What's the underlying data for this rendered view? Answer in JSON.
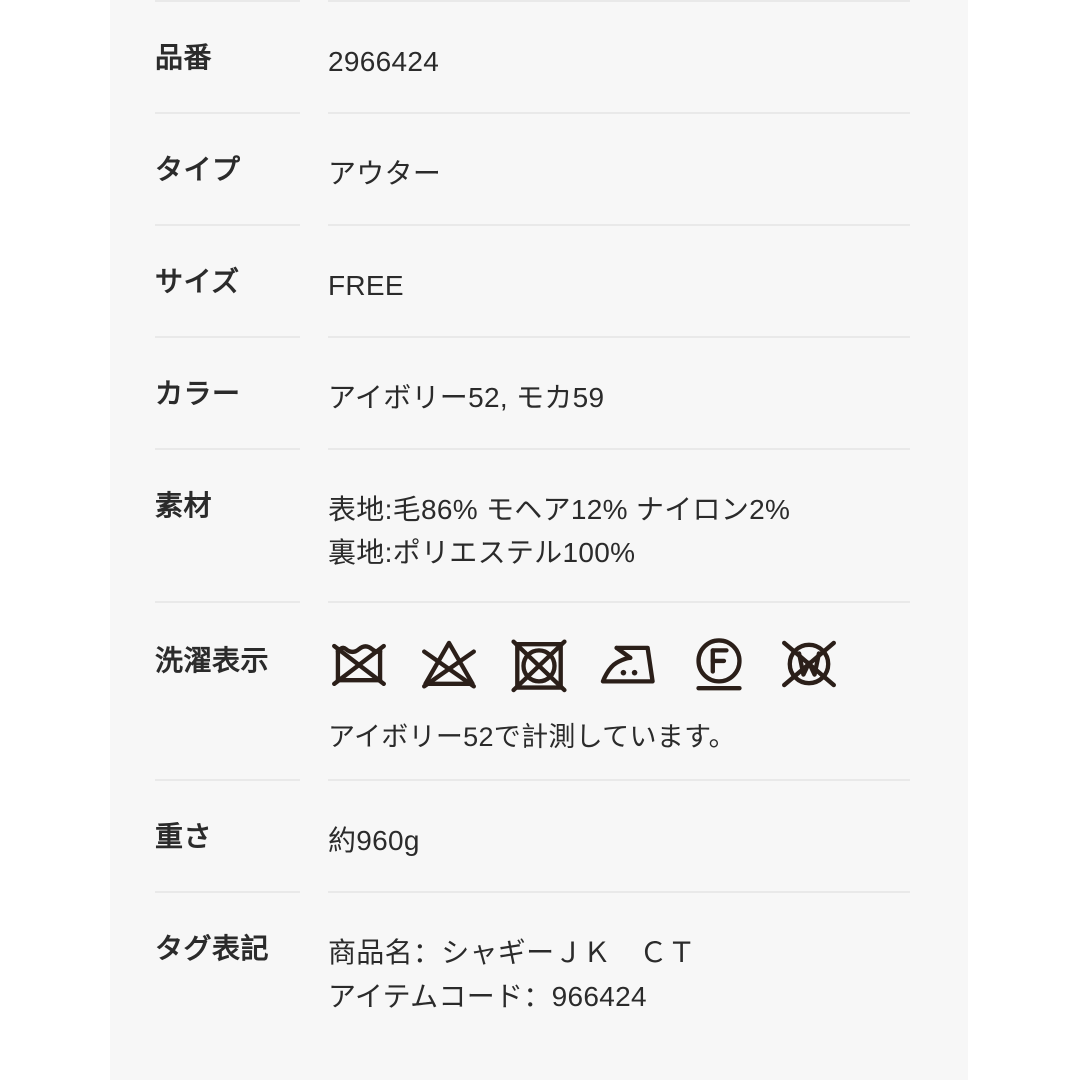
{
  "panel": {
    "background_color": "#f7f7f7",
    "page_background_color": "#ffffff",
    "divider_color": "#e9e9e9",
    "text_color": "#2b2b2b"
  },
  "spec_rows": [
    {
      "label": "品番",
      "value_lines": [
        "2966424"
      ]
    },
    {
      "label": "タイプ",
      "value_lines": [
        "アウター"
      ]
    },
    {
      "label": "サイズ",
      "value_lines": [
        "FREE"
      ]
    },
    {
      "label": "カラー",
      "value_lines": [
        "アイボリー52, モカ59"
      ]
    },
    {
      "label": "素材",
      "value_lines": [
        "表地:毛86% モヘア12% ナイロン2%",
        "裏地:ポリエステル100%"
      ]
    }
  ],
  "care": {
    "label": "洗濯表示",
    "note": "アイボリー52で計測しています。",
    "symbols": [
      {
        "name": "do-not-wash-icon",
        "title": "家庭洗濯禁止"
      },
      {
        "name": "do-not-bleach-icon",
        "title": "漂白処理禁止"
      },
      {
        "name": "do-not-tumble-dry-icon",
        "title": "タンブル乾燥禁止"
      },
      {
        "name": "iron-medium-heat-icon",
        "title": "中温アイロン仕上げ"
      },
      {
        "name": "dry-clean-petroleum-gentle-icon",
        "title": "石油系ドライクリーニング弱"
      },
      {
        "name": "do-not-wet-clean-icon",
        "title": "ウエットクリーニング禁止"
      }
    ]
  },
  "weight_row": {
    "label": "重さ",
    "value_lines": [
      "約960g"
    ]
  },
  "tag_row": {
    "label": "タグ表記",
    "value_lines": [
      "商品名：シャギーＪＫ　ＣＴ",
      "アイテムコード：966424"
    ]
  }
}
